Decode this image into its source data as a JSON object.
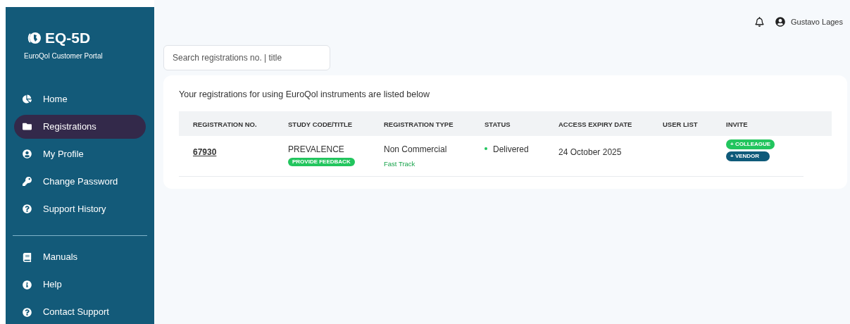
{
  "brand": {
    "logo": "EQ-5D",
    "subtitle": "EuroQol Customer Portal"
  },
  "nav": [
    {
      "label": "Home",
      "selected": false
    },
    {
      "label": "Registrations",
      "selected": true
    },
    {
      "label": "My Profile",
      "selected": false
    },
    {
      "label": "Change Password",
      "selected": false
    },
    {
      "label": "Support History",
      "selected": false
    }
  ],
  "nav_secondary": [
    {
      "label": "Manuals",
      "selected": false
    },
    {
      "label": "Help",
      "selected": false
    },
    {
      "label": "Contact Support",
      "selected": false
    }
  ],
  "header": {
    "user": "Gustavo Lages"
  },
  "search": {
    "placeholder": "Search registrations no. | title"
  },
  "card": {
    "title": "Your registrations for using EuroQol instruments are listed below"
  },
  "table": {
    "columns": [
      "REGISTRATION NO.",
      "STUDY CODE/TITLE",
      "REGISTRATION TYPE",
      "STATUS",
      "ACCESS EXPIRY DATE",
      "USER LIST",
      "INVITE"
    ],
    "rows": [
      {
        "registration_no": "67930",
        "study": "PREVALENCE",
        "feedback": "PROVIDE FEEDBACK",
        "type": "Non Commercial",
        "track": "Fast Track",
        "status": {
          "label": "Delivered",
          "color": "#22c55e"
        },
        "expiry": "24 October 2025",
        "invites": [
          {
            "label": "+ COLLEAGUE",
            "color": "#22c55e"
          },
          {
            "label": "+ VENDOR",
            "color": "#0f5a7a"
          }
        ]
      }
    ]
  }
}
